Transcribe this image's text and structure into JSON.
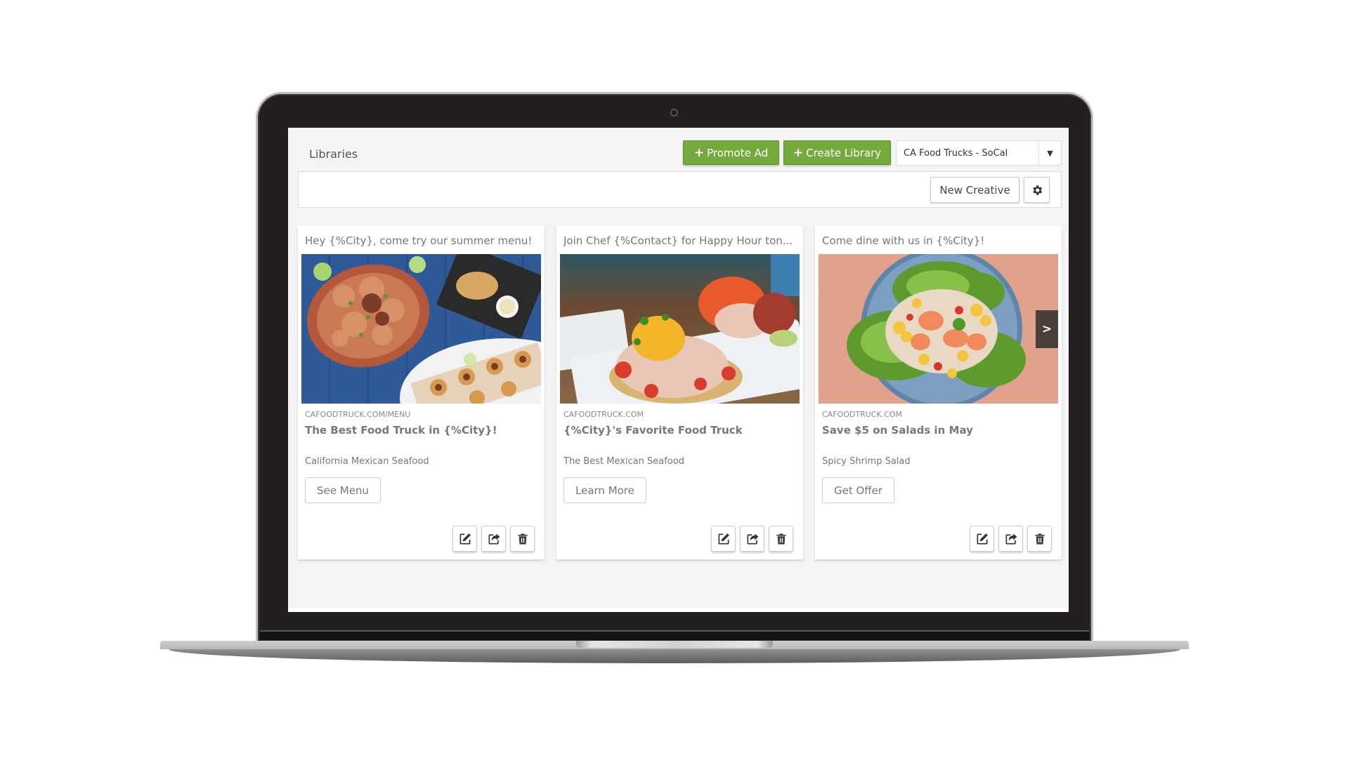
{
  "header": {
    "title": "Libraries",
    "promote_ad_label": "Promote Ad",
    "create_library_label": "Create Library",
    "plus_glyph": "+",
    "library_select": {
      "selected": "CA Food Trucks - SoCal",
      "caret_glyph": "▼"
    }
  },
  "toolbar": {
    "new_creative_label": "New Creative",
    "settings_icon": "gear-icon"
  },
  "colors": {
    "accent_green": "#74a93b",
    "screen_bg": "#f4f4f4",
    "bezel": "#231f20"
  },
  "cards": [
    {
      "message": "Hey {%City}, come try our summer menu!",
      "image_subject": "seafood platter on blue wood table",
      "url": "CAFOODTRUCK.COM/MENU",
      "headline": "The Best Food Truck in {%City}!",
      "description": "California Mexican Seafood",
      "cta_label": "See Menu",
      "actions": [
        "edit-icon",
        "share-icon",
        "trash-icon"
      ]
    },
    {
      "message": "Join Chef {%Contact} for Happy Hour ton...",
      "image_subject": "ceviche tostadas",
      "url": "CAFOODTRUCK.COM",
      "headline": "{%City}'s Favorite Food Truck",
      "description": "The Best Mexican Seafood",
      "cta_label": "Learn More",
      "actions": [
        "edit-icon",
        "share-icon",
        "trash-icon"
      ]
    },
    {
      "message": "Come dine with us in {%City}!",
      "image_subject": "spicy shrimp salad bowl",
      "url": "CAFOODTRUCK.COM",
      "headline": "Save $5 on Salads in May",
      "description": "Spicy Shrimp Salad",
      "cta_label": "Get Offer",
      "actions": [
        "edit-icon",
        "share-icon",
        "trash-icon"
      ],
      "carousel_next_glyph": ">"
    }
  ]
}
